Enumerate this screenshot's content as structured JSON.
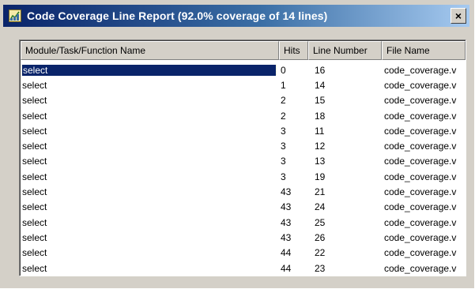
{
  "window": {
    "title": "Code Coverage Line Report (92.0% coverage of 14 lines)",
    "close_label": "×",
    "title_icon": "report-chart-icon"
  },
  "columns": [
    "Module/Task/Function Name",
    "Hits",
    "Line Number",
    "File Name"
  ],
  "rows": [
    {
      "name": "select",
      "hits": "0",
      "line": "16",
      "file": "code_coverage.v",
      "selected": true
    },
    {
      "name": "select",
      "hits": "1",
      "line": "14",
      "file": "code_coverage.v"
    },
    {
      "name": "select",
      "hits": "2",
      "line": "15",
      "file": "code_coverage.v"
    },
    {
      "name": "select",
      "hits": "2",
      "line": "18",
      "file": "code_coverage.v"
    },
    {
      "name": "select",
      "hits": "3",
      "line": "11",
      "file": "code_coverage.v"
    },
    {
      "name": "select",
      "hits": "3",
      "line": "12",
      "file": "code_coverage.v"
    },
    {
      "name": "select",
      "hits": "3",
      "line": "13",
      "file": "code_coverage.v"
    },
    {
      "name": "select",
      "hits": "3",
      "line": "19",
      "file": "code_coverage.v"
    },
    {
      "name": "select",
      "hits": "43",
      "line": "21",
      "file": "code_coverage.v"
    },
    {
      "name": "select",
      "hits": "43",
      "line": "24",
      "file": "code_coverage.v"
    },
    {
      "name": "select",
      "hits": "43",
      "line": "25",
      "file": "code_coverage.v"
    },
    {
      "name": "select",
      "hits": "43",
      "line": "26",
      "file": "code_coverage.v"
    },
    {
      "name": "select",
      "hits": "44",
      "line": "22",
      "file": "code_coverage.v"
    },
    {
      "name": "select",
      "hits": "44",
      "line": "23",
      "file": "code_coverage.v"
    }
  ],
  "colors": {
    "titlebar_start": "#0a246a",
    "titlebar_end": "#a6caf0",
    "selection": "#0a246a",
    "face": "#d4d0c8"
  }
}
